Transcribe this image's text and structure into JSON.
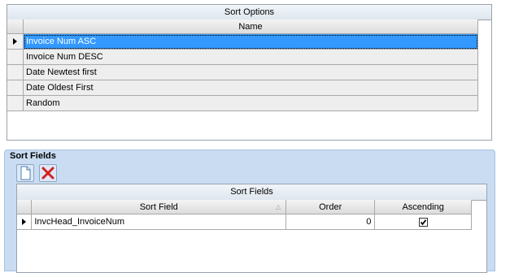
{
  "sort_options": {
    "caption": "Sort Options",
    "column_header": "Name",
    "rows": [
      {
        "name": "Invoice Num ASC",
        "selected": true
      },
      {
        "name": "Invoice Num DESC",
        "selected": false
      },
      {
        "name": "Date Newtest first",
        "selected": false
      },
      {
        "name": "Date Oldest First",
        "selected": false
      },
      {
        "name": "Random",
        "selected": false
      }
    ]
  },
  "sort_fields": {
    "group_title": "Sort Fields",
    "toolbar": {
      "new_icon": "new-document-icon",
      "delete_icon": "delete-x-icon"
    },
    "caption": "Sort Fields",
    "columns": [
      "Sort Field",
      "Order",
      "Ascending"
    ],
    "rows": [
      {
        "sort_field": "InvcHead_InvoiceNum",
        "order": "0",
        "ascending": true
      }
    ]
  },
  "colors": {
    "selection": "#3399ff",
    "group_background": "#c9dcf1",
    "delete_red": "#d42020"
  }
}
